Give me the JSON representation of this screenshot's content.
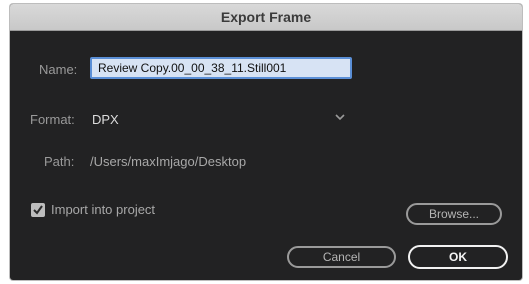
{
  "dialog": {
    "title": "Export Frame",
    "name_label": "Name:",
    "name_value": "Review Copy.00_00_38_11.Still001",
    "format_label": "Format:",
    "format_value": "DPX",
    "path_label": "Path:",
    "path_value": "/Users/maxImjago/Desktop",
    "import_label": "Import into project",
    "import_checked": true,
    "browse_label": "Browse...",
    "cancel_label": "Cancel",
    "ok_label": "OK"
  },
  "icons": {
    "format_dropdown": "chevron-down-icon",
    "import_checkbox": "checkmark-icon"
  },
  "colors": {
    "dialog_bg": "#222223",
    "titlebar_bg": "#d0d0d0",
    "name_field_bg": "#d7e3f4",
    "name_field_border": "#5b8fd6"
  }
}
